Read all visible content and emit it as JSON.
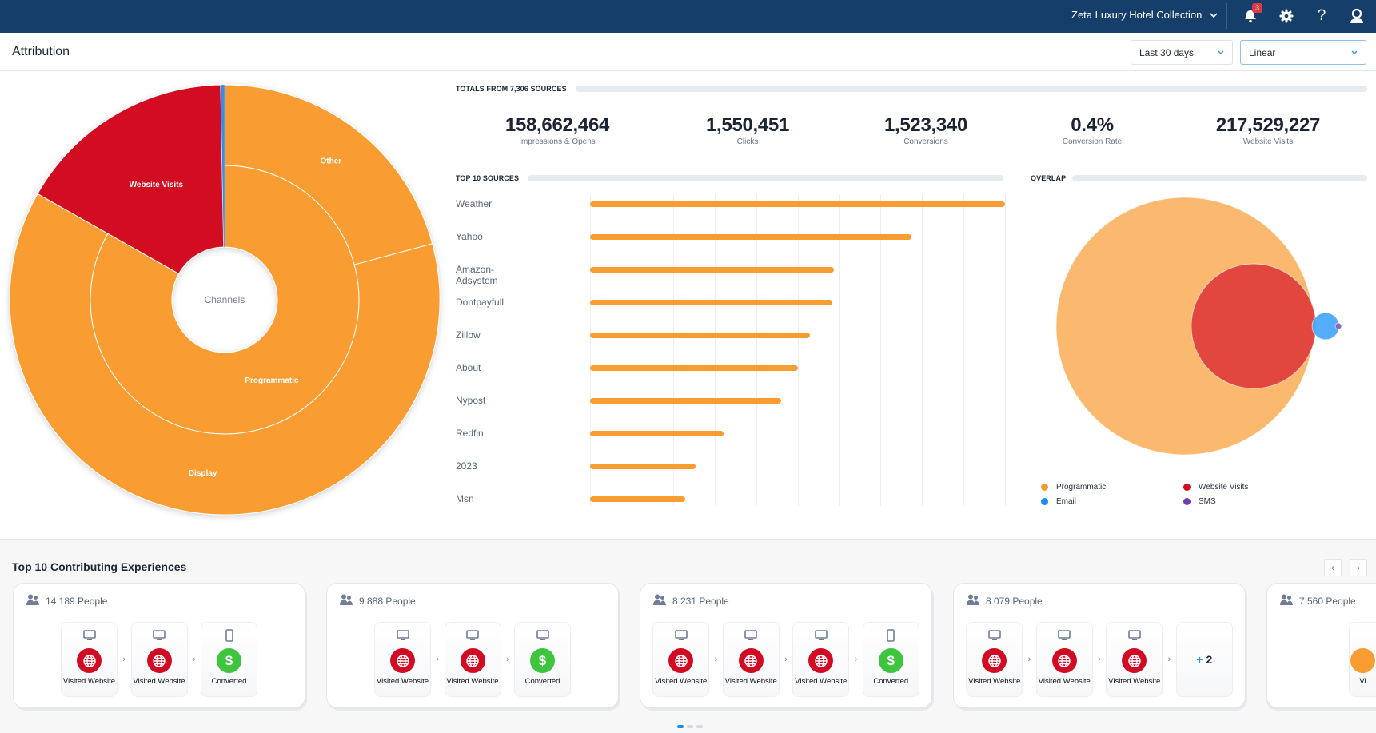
{
  "header": {
    "org_name": "Zeta Luxury Hotel Collection",
    "notifications_count": "3",
    "icons": [
      "chevron-down-icon",
      "bell-icon",
      "gear-icon",
      "help-icon",
      "user-icon"
    ]
  },
  "page": {
    "title": "Attribution",
    "date_range": "Last 30 days",
    "model": "Linear"
  },
  "totals": {
    "heading": "TOTALS FROM 7,306 SOURCES",
    "stats": [
      {
        "value": "158,662,464",
        "label": "Impressions & Opens"
      },
      {
        "value": "1,550,451",
        "label": "Clicks"
      },
      {
        "value": "1,523,340",
        "label": "Conversions"
      },
      {
        "value": "0.4%",
        "label": "Conversion Rate"
      },
      {
        "value": "217,529,227",
        "label": "Website Visits"
      }
    ]
  },
  "colors": {
    "header_bg": "#163e6b",
    "programmatic": "#f99d33",
    "website_visits": "#d20b24",
    "email": "#2f8ff0",
    "sms": "#7f55b5",
    "converted": "#3ec43e"
  },
  "chart_data": [
    {
      "type": "sunburst",
      "center_label": "Channels",
      "unit": "percent of total",
      "segments": [
        {
          "name": "Programmatic",
          "value": 83.2,
          "color": "#f99d33",
          "label_shown": true,
          "children": [
            {
              "name": "Other",
              "value": 20.8,
              "color": "#f99d33"
            },
            {
              "name": "Display",
              "value": 62.4,
              "color": "#f99d33"
            }
          ]
        },
        {
          "name": "Website Visits",
          "value": 16.5,
          "color": "#d20b24",
          "label_shown": true
        },
        {
          "name": "Email",
          "value": 0.3,
          "color": "#2f8ff0",
          "label_shown": false
        }
      ]
    },
    {
      "type": "bar",
      "orientation": "horizontal",
      "title": "TOP 10 SOURCES",
      "unit": "percent of largest source",
      "categories": [
        "Weather",
        "Yahoo",
        "Amazon-Adsystem",
        "Dontpayfull",
        "Zillow",
        "About",
        "Nypost",
        "Redfin",
        "2023",
        "Msn"
      ],
      "values": [
        100,
        77.4,
        58.8,
        58.4,
        52.9,
        50.1,
        46.1,
        32.2,
        25.4,
        22.9
      ],
      "xlim": [
        0,
        100
      ],
      "gridlines": 10,
      "grid": true,
      "bar_color": "#f99d33"
    },
    {
      "type": "venn",
      "title": "OVERLAP",
      "unit": "relative set size",
      "sets": [
        {
          "name": "Programmatic",
          "value": 100,
          "color": "#fab96f"
        },
        {
          "name": "Website Visits",
          "value": 23.5,
          "color": "#df403b"
        },
        {
          "name": "Email",
          "value": 1.1,
          "color": "#4aa8fc"
        },
        {
          "name": "SMS",
          "value": 0.06,
          "color": "#8a5fc0"
        }
      ],
      "legend": [
        {
          "name": "Programmatic",
          "color": "#f99d33"
        },
        {
          "name": "Website Visits",
          "color": "#d20b24"
        },
        {
          "name": "Email",
          "color": "#1a8cff"
        },
        {
          "name": "SMS",
          "color": "#6f3fb0"
        }
      ],
      "legend_position": "bottom"
    }
  ],
  "experiences": {
    "title": "Top 10 Contributing Experiences",
    "prev_label": "‹",
    "next_label": "›",
    "page": 1,
    "pages": 3,
    "cards": [
      {
        "people": "14 189 People",
        "steps": [
          {
            "device": "desktop",
            "type": "web",
            "label": "Visited Website"
          },
          {
            "device": "desktop",
            "type": "web",
            "label": "Visited Website"
          },
          {
            "device": "mobile",
            "type": "converted",
            "label": "Converted"
          }
        ]
      },
      {
        "people": "9 888 People",
        "steps": [
          {
            "device": "desktop",
            "type": "web",
            "label": "Visited Website"
          },
          {
            "device": "desktop",
            "type": "web",
            "label": "Visited Website"
          },
          {
            "device": "desktop",
            "type": "converted",
            "label": "Converted"
          }
        ]
      },
      {
        "people": "8 231 People",
        "steps": [
          {
            "device": "desktop",
            "type": "web",
            "label": "Visited Website"
          },
          {
            "device": "desktop",
            "type": "web",
            "label": "Visited Website"
          },
          {
            "device": "desktop",
            "type": "web",
            "label": "Visited Website"
          },
          {
            "device": "mobile",
            "type": "converted",
            "label": "Converted"
          }
        ]
      },
      {
        "people": "8 079 People",
        "steps": [
          {
            "device": "desktop",
            "type": "web",
            "label": "Visited Website"
          },
          {
            "device": "desktop",
            "type": "web",
            "label": "Visited Website"
          },
          {
            "device": "desktop",
            "type": "web",
            "label": "Visited Website"
          }
        ],
        "more": "2"
      },
      {
        "people": "7 560 People",
        "steps": [
          {
            "device": "none",
            "type": "programmatic",
            "label": "Vi"
          }
        ]
      }
    ]
  }
}
